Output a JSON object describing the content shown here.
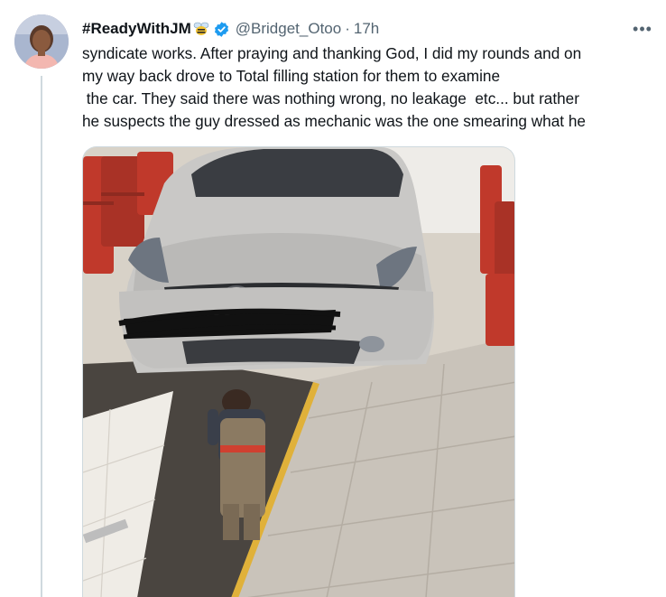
{
  "tweet": {
    "display_name": "#ReadyWithJM",
    "handle": "@Bridget_Otoo",
    "separator": "·",
    "time": "17h",
    "more_label": "•••",
    "lines": [
      "syndicate works. After praying and thanking God, I did my rounds and on",
      "my way back drove to Total filling station for them to examine",
      " the car. They said there was nothing wrong, no leakage  etc... but rather",
      "he suspects the guy dressed as mechanic was the one smearing what he"
    ]
  },
  "icons": {
    "emoji": "bee-icon",
    "badge": "verified-badge-icon",
    "more": "more-options-icon"
  },
  "colors": {
    "verified": "#1d9bf0",
    "muted_text": "#536471",
    "body_text": "#0f1419"
  }
}
